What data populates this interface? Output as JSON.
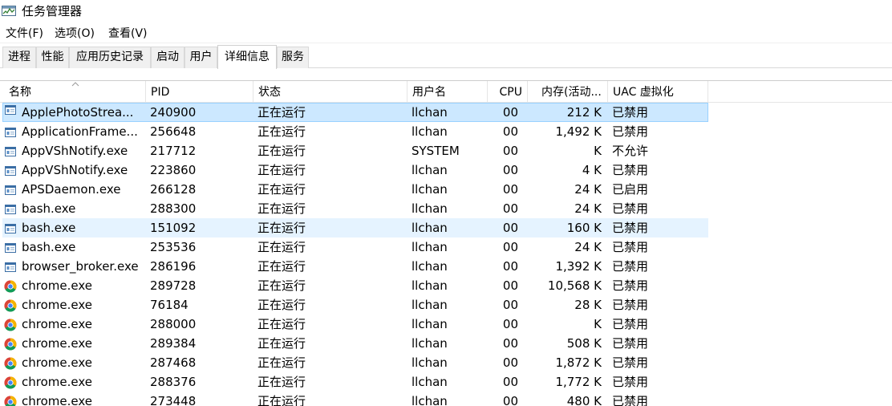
{
  "window": {
    "title": "任务管理器",
    "icon": "task-manager-icon"
  },
  "menu": [
    "文件(F)",
    "选项(O)",
    "查看(V)"
  ],
  "tabs": [
    {
      "label": "进程",
      "active": false
    },
    {
      "label": "性能",
      "active": false
    },
    {
      "label": "应用历史记录",
      "active": false
    },
    {
      "label": "启动",
      "active": false
    },
    {
      "label": "用户",
      "active": false
    },
    {
      "label": "详细信息",
      "active": true
    },
    {
      "label": "服务",
      "active": false
    }
  ],
  "columns": [
    "名称",
    "PID",
    "状态",
    "用户名",
    "CPU",
    "内存(活动...",
    "UAC 虚拟化"
  ],
  "sort": {
    "column": "名称",
    "direction": "ascending"
  },
  "rows": [
    {
      "name": "ApplePhotoStrea...",
      "pid": "240900",
      "status": "正在运行",
      "user": "llchan",
      "cpu": "00",
      "mem": "212 K",
      "uac": "已禁用",
      "icon": "app-window-icon",
      "state": "selected"
    },
    {
      "name": "ApplicationFrame...",
      "pid": "256648",
      "status": "正在运行",
      "user": "llchan",
      "cpu": "00",
      "mem": "1,492 K",
      "uac": "已禁用",
      "icon": "app-window-icon",
      "state": ""
    },
    {
      "name": "AppVShNotify.exe",
      "pid": "217712",
      "status": "正在运行",
      "user": "SYSTEM",
      "cpu": "00",
      "mem": "K",
      "uac": "不允许",
      "icon": "app-window-icon",
      "state": ""
    },
    {
      "name": "AppVShNotify.exe",
      "pid": "223860",
      "status": "正在运行",
      "user": "llchan",
      "cpu": "00",
      "mem": "4 K",
      "uac": "已禁用",
      "icon": "app-window-icon",
      "state": ""
    },
    {
      "name": "APSDaemon.exe",
      "pid": "266128",
      "status": "正在运行",
      "user": "llchan",
      "cpu": "00",
      "mem": "24 K",
      "uac": "已启用",
      "icon": "app-window-icon",
      "state": ""
    },
    {
      "name": "bash.exe",
      "pid": "288300",
      "status": "正在运行",
      "user": "llchan",
      "cpu": "00",
      "mem": "24 K",
      "uac": "已禁用",
      "icon": "app-window-icon",
      "state": ""
    },
    {
      "name": "bash.exe",
      "pid": "151092",
      "status": "正在运行",
      "user": "llchan",
      "cpu": "00",
      "mem": "160 K",
      "uac": "已禁用",
      "icon": "app-window-icon",
      "state": "hover"
    },
    {
      "name": "bash.exe",
      "pid": "253536",
      "status": "正在运行",
      "user": "llchan",
      "cpu": "00",
      "mem": "24 K",
      "uac": "已禁用",
      "icon": "app-window-icon",
      "state": ""
    },
    {
      "name": "browser_broker.exe",
      "pid": "286196",
      "status": "正在运行",
      "user": "llchan",
      "cpu": "00",
      "mem": "1,392 K",
      "uac": "已禁用",
      "icon": "app-window-icon",
      "state": ""
    },
    {
      "name": "chrome.exe",
      "pid": "289728",
      "status": "正在运行",
      "user": "llchan",
      "cpu": "00",
      "mem": "10,568 K",
      "uac": "已禁用",
      "icon": "chrome-icon",
      "state": ""
    },
    {
      "name": "chrome.exe",
      "pid": "76184",
      "status": "正在运行",
      "user": "llchan",
      "cpu": "00",
      "mem": "28 K",
      "uac": "已禁用",
      "icon": "chrome-icon",
      "state": ""
    },
    {
      "name": "chrome.exe",
      "pid": "288000",
      "status": "正在运行",
      "user": "llchan",
      "cpu": "00",
      "mem": "K",
      "uac": "已禁用",
      "icon": "chrome-icon",
      "state": ""
    },
    {
      "name": "chrome.exe",
      "pid": "289384",
      "status": "正在运行",
      "user": "llchan",
      "cpu": "00",
      "mem": "508 K",
      "uac": "已禁用",
      "icon": "chrome-icon",
      "state": ""
    },
    {
      "name": "chrome.exe",
      "pid": "287468",
      "status": "正在运行",
      "user": "llchan",
      "cpu": "00",
      "mem": "1,872 K",
      "uac": "已禁用",
      "icon": "chrome-icon",
      "state": ""
    },
    {
      "name": "chrome.exe",
      "pid": "288376",
      "status": "正在运行",
      "user": "llchan",
      "cpu": "00",
      "mem": "1,772 K",
      "uac": "已禁用",
      "icon": "chrome-icon",
      "state": ""
    },
    {
      "name": "chrome.exe",
      "pid": "273448",
      "status": "正在运行",
      "user": "llchan",
      "cpu": "00",
      "mem": "480 K",
      "uac": "已禁用",
      "icon": "chrome-icon",
      "state": ""
    }
  ],
  "colors": {
    "selected_bg": "#cce8ff",
    "selected_border": "#99d1ff",
    "hover_bg": "#e5f3ff"
  }
}
